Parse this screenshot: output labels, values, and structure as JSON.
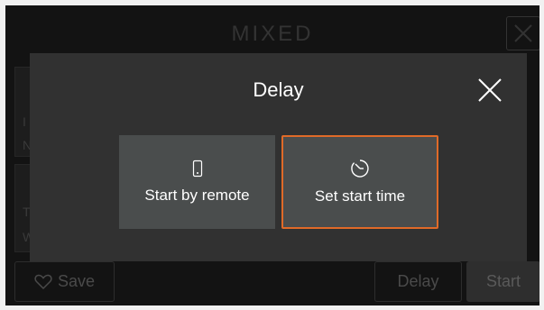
{
  "header": {
    "title": "MIXED",
    "close_icon": "close-icon"
  },
  "background": {
    "letters": [
      "I",
      "N",
      "T",
      "W"
    ]
  },
  "footer": {
    "save_label": "Save",
    "delay_label": "Delay",
    "start_label": "Start"
  },
  "modal": {
    "title": "Delay",
    "options": [
      {
        "label": "Start by remote",
        "icon": "phone-icon",
        "selected": false
      },
      {
        "label": "Set start time",
        "icon": "clock-icon",
        "selected": true
      }
    ]
  },
  "colors": {
    "accent": "#e06a28",
    "modal_bg": "#313131",
    "option_bg": "#4a4d4d"
  }
}
